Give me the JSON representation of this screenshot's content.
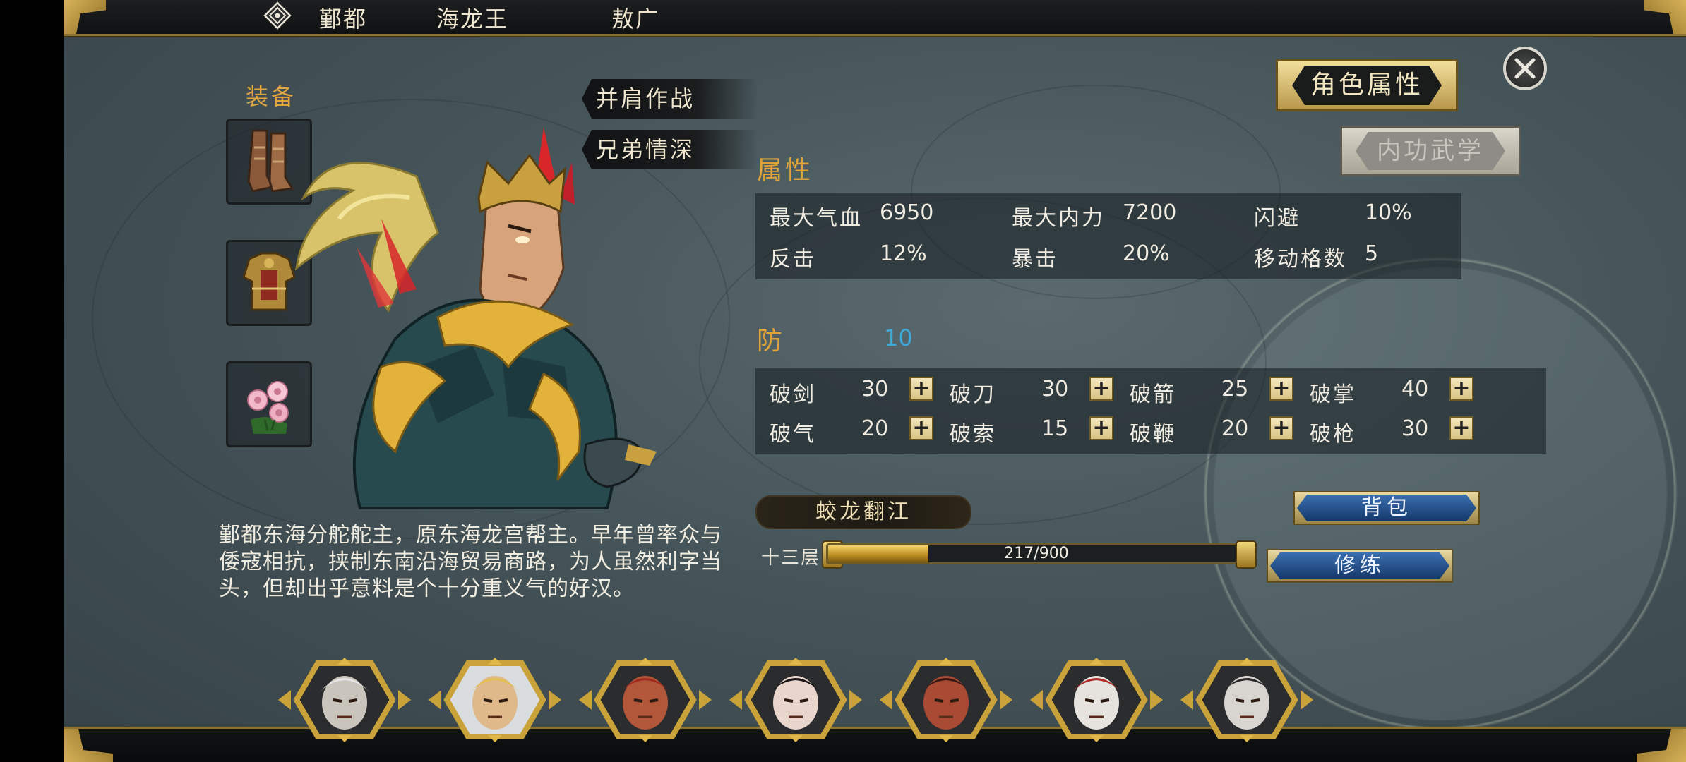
{
  "header": {
    "faction": "鄞都",
    "title": "海龙王",
    "name": "敖广"
  },
  "equipment": {
    "title": "装备",
    "slots": [
      {
        "icon": "boots-icon"
      },
      {
        "icon": "armor-icon"
      },
      {
        "icon": "flower-icon"
      }
    ]
  },
  "bond_tags": [
    "并肩作战",
    "兄弟情深"
  ],
  "description": "鄞都东海分舵舵主，原东海龙宫帮主。早年曾率众与倭寇相抗，挟制东南沿海贸易商路，为人虽然利字当头，但却出乎意料是个十分重义气的好汉。",
  "tabs": {
    "active": "角色属性",
    "inactive": "内功武学"
  },
  "attributes": {
    "title": "属性",
    "rows": [
      [
        {
          "label": "最大气血",
          "value": "6950"
        },
        {
          "label": "最大内力",
          "value": "7200"
        },
        {
          "label": "闪避",
          "value": "10%"
        }
      ],
      [
        {
          "label": "反击",
          "value": "12%"
        },
        {
          "label": "暴击",
          "value": "20%"
        },
        {
          "label": "移动格数",
          "value": "5"
        }
      ]
    ]
  },
  "defense": {
    "title": "防",
    "value": "10",
    "rows": [
      [
        {
          "label": "破剑",
          "value": "30"
        },
        {
          "label": "破刀",
          "value": "30"
        },
        {
          "label": "破箭",
          "value": "25"
        },
        {
          "label": "破掌",
          "value": "40"
        }
      ],
      [
        {
          "label": "破气",
          "value": "20"
        },
        {
          "label": "破索",
          "value": "15"
        },
        {
          "label": "破鞭",
          "value": "20"
        },
        {
          "label": "破枪",
          "value": "30"
        }
      ]
    ]
  },
  "skill": {
    "name": "蛟龙翻江",
    "level": "十三层",
    "progress_text": "217/900",
    "progress_fraction": 0.241
  },
  "actions": {
    "bag": "背包",
    "train": "修练"
  },
  "roster": {
    "selected_index": 1,
    "heroes": [
      "hero-portrait-1",
      "hero-portrait-2",
      "hero-portrait-3",
      "hero-portrait-4",
      "hero-portrait-5",
      "hero-portrait-6",
      "hero-portrait-7"
    ]
  },
  "colors": {
    "accent_gold": "#e0a23a",
    "defense_value": "#3fa9dc",
    "button_blue": "#1d4f92"
  }
}
